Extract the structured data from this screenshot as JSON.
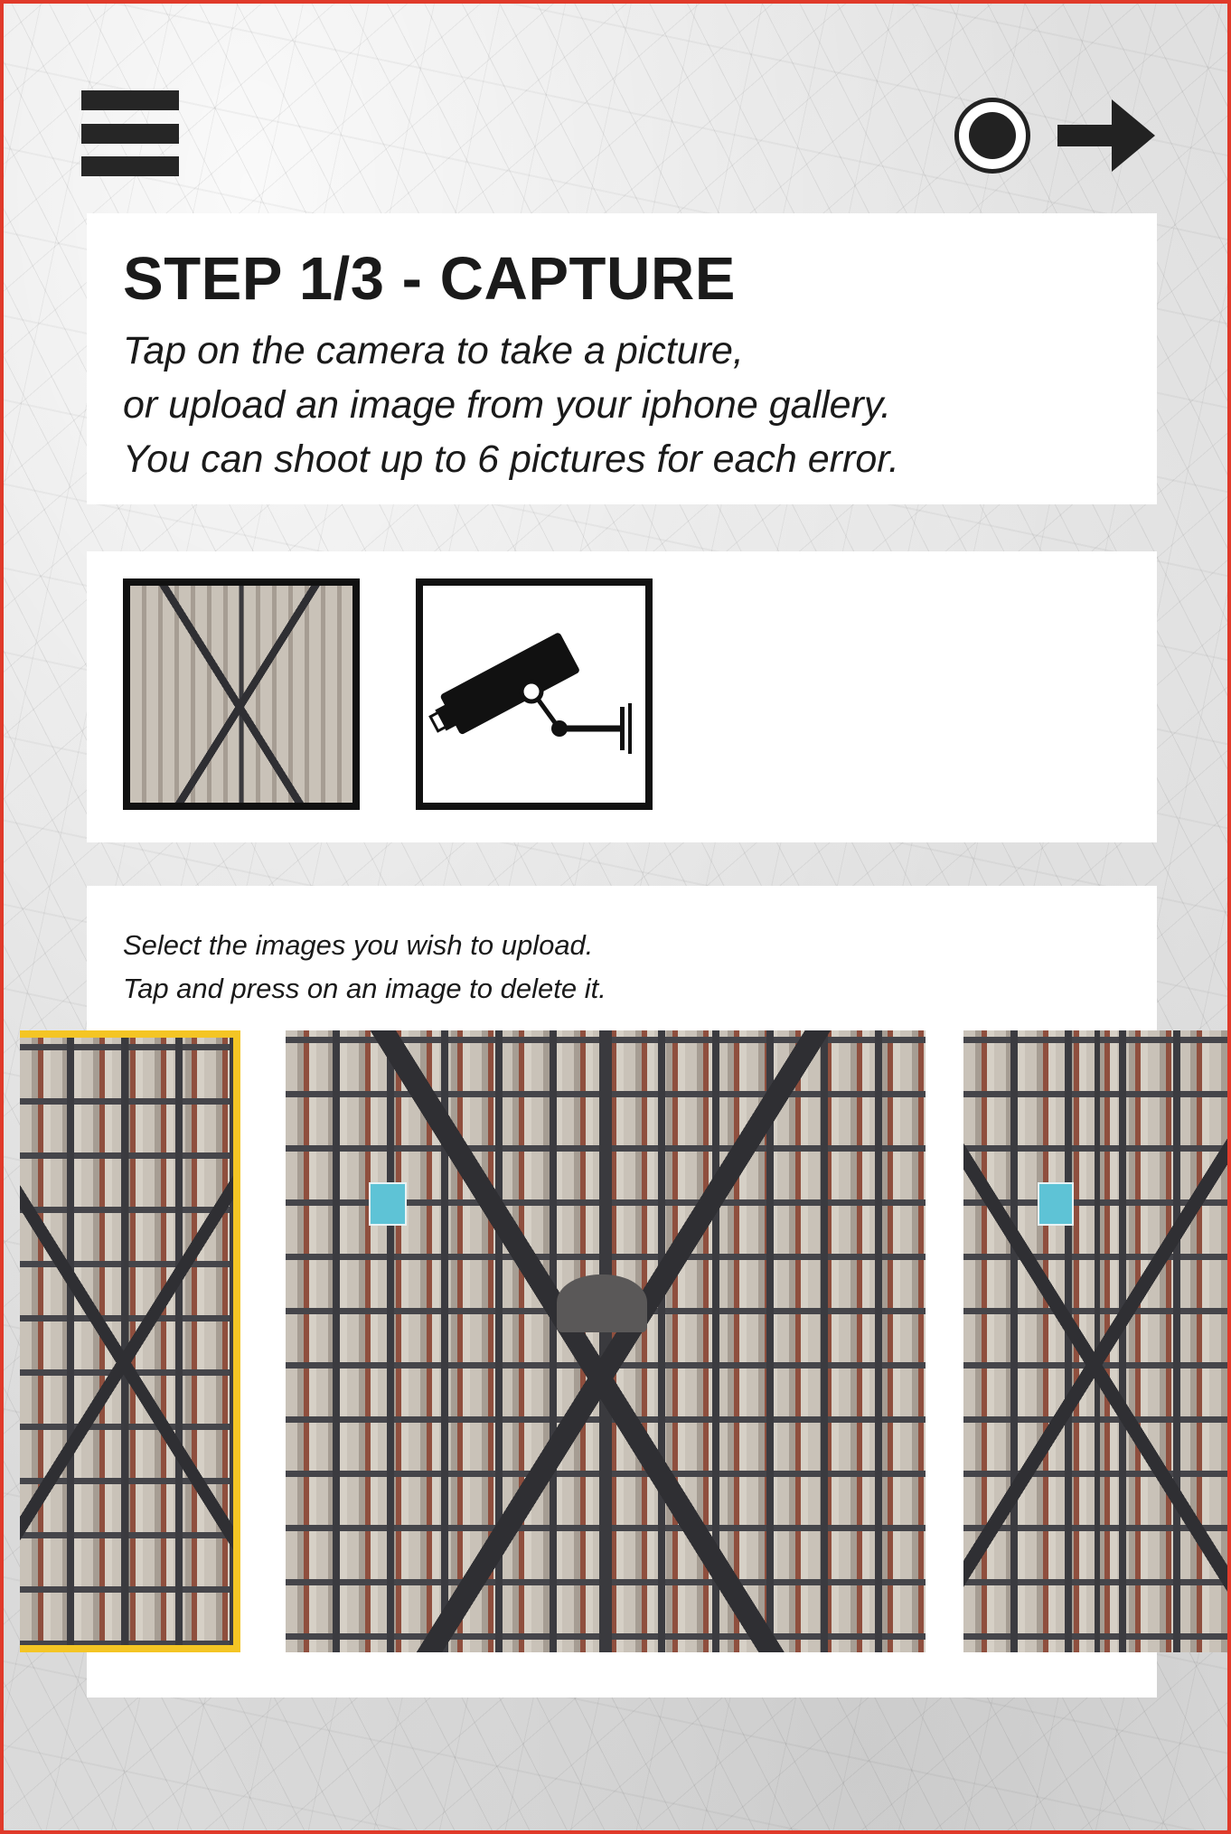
{
  "header": {
    "menu_icon": "hamburger-menu-icon",
    "record_icon": "record-circle-icon",
    "next_icon": "arrow-right-icon"
  },
  "step": {
    "title": "STEP 1/3 - CAPTURE",
    "lines": [
      "Tap on the camera to take a picture,",
      "or upload an image from your iphone gallery.",
      "You can shoot up to 6 pictures for each error."
    ]
  },
  "captures": {
    "thumbnail_icon": "aerial-photo-thumbnail",
    "camera_icon": "security-camera-icon"
  },
  "gallery": {
    "hint_lines": [
      "Select the images you wish to upload.",
      "Tap and press on an image to delete it."
    ],
    "selected_color": "#f4c524"
  },
  "colors": {
    "frame_border": "#e03a2a",
    "text": "#1a1a1a"
  }
}
